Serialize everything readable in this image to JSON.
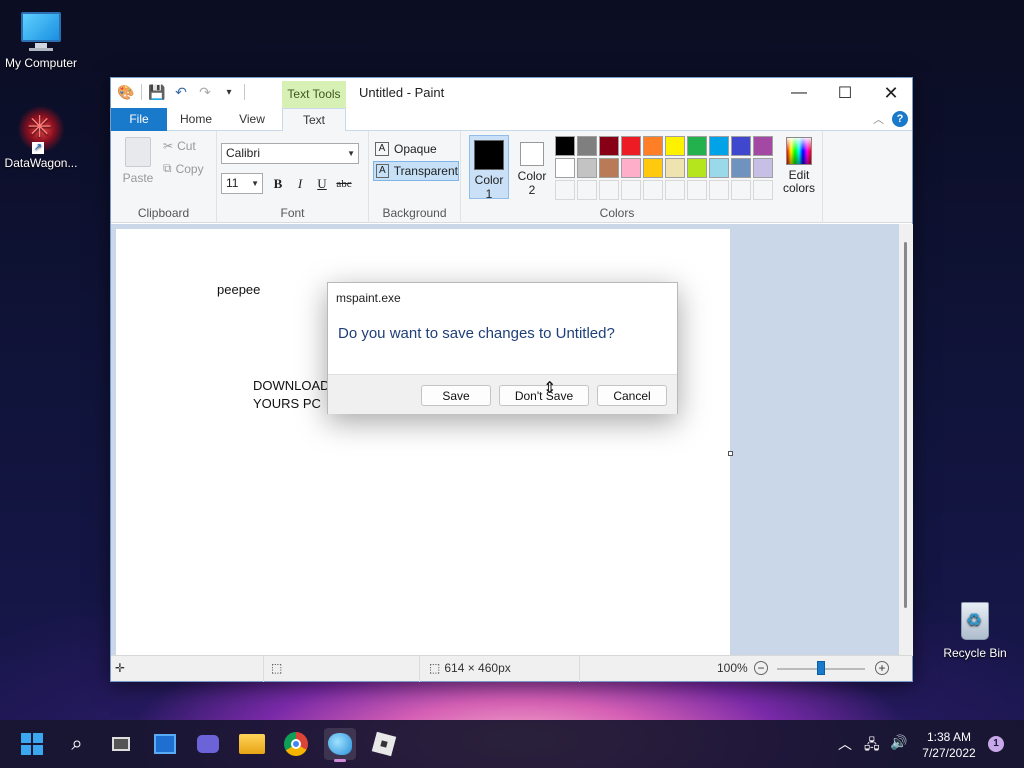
{
  "desktop": {
    "icons": [
      {
        "label": "My Computer"
      },
      {
        "label": "DataWagon..."
      },
      {
        "label": "Recycle Bin"
      }
    ]
  },
  "window": {
    "title": "Untitled - Paint",
    "contextual_tab": "Text Tools",
    "tabs": [
      "File",
      "Home",
      "View",
      "Text"
    ],
    "active_tab": "Text"
  },
  "ribbon": {
    "clipboard": {
      "label": "Clipboard",
      "paste": "Paste",
      "cut": "Cut",
      "copy": "Copy"
    },
    "font": {
      "label": "Font",
      "family": "Calibri",
      "size": "11",
      "bold": "B",
      "italic": "I",
      "underline": "U",
      "strike": "abc"
    },
    "background": {
      "label": "Background",
      "opaque": "Opaque",
      "transparent": "Transparent",
      "selected": "Transparent"
    },
    "colors": {
      "label": "Colors",
      "color1_label": "Color 1",
      "color2_label": "Color 2",
      "color1": "#000000",
      "color2": "#ffffff",
      "palette": [
        "#000000",
        "#7f7f7f",
        "#880015",
        "#ed1c24",
        "#ff7f27",
        "#fff200",
        "#22b14c",
        "#00a2e8",
        "#3f48cc",
        "#a349a4",
        "#ffffff",
        "#c3c3c3",
        "#b97a57",
        "#ffaec9",
        "#ffc90e",
        "#efe4b0",
        "#b5e61d",
        "#99d9ea",
        "#7092be",
        "#c8bfe7"
      ],
      "edit_colors": "Edit colors"
    }
  },
  "canvas": {
    "texts": [
      "peepee",
      "DOWNLOAD",
      "YOURS PC"
    ]
  },
  "status": {
    "size": "614 × 460px",
    "zoom": "100%",
    "zoom_out": "−",
    "zoom_in": "+"
  },
  "dialog": {
    "title": "mspaint.exe",
    "message": "Do you want to save changes to Untitled?",
    "buttons": {
      "save": "Save",
      "dont_save": "Don't Save",
      "cancel": "Cancel"
    }
  },
  "taskbar": {
    "time": "1:38 AM",
    "date": "7/27/2022",
    "notifications": "1"
  },
  "colors": {
    "accent": "#1979ca",
    "contextual_tab_bg": "#d7f0b4",
    "dialog_message": "#1f3f7a"
  }
}
